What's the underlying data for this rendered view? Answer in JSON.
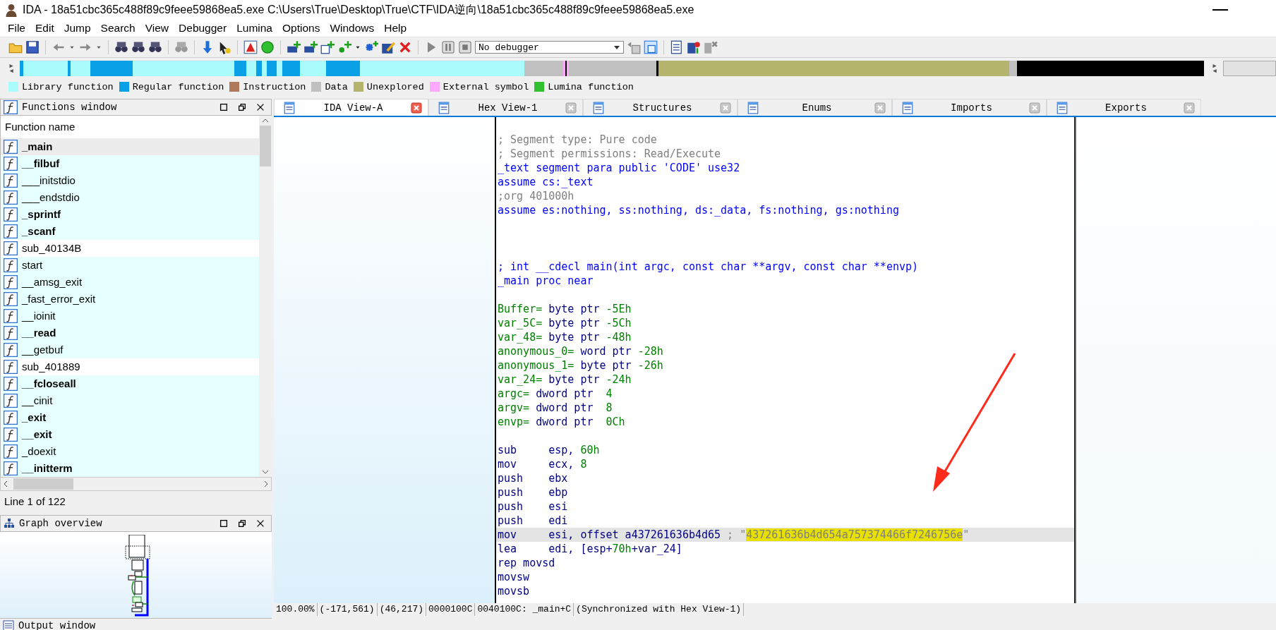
{
  "window": {
    "title": "IDA - 18a51cbc365c488f89c9feee59868ea5.exe C:\\Users\\True\\Desktop\\True\\CTF\\IDA逆向\\18a51cbc365c488f89c9feee59868ea5.exe"
  },
  "menu": [
    "File",
    "Edit",
    "Jump",
    "Search",
    "View",
    "Debugger",
    "Lumina",
    "Options",
    "Windows",
    "Help"
  ],
  "toolbar": {
    "debugger_select": "No debugger"
  },
  "legend": [
    {
      "label": "Library function",
      "color": "#aafcfc"
    },
    {
      "label": "Regular function",
      "color": "#0aa0e6"
    },
    {
      "label": "Instruction",
      "color": "#b07a5a"
    },
    {
      "label": "Data",
      "color": "#c0c0c0"
    },
    {
      "label": "Unexplored",
      "color": "#b4b46c"
    },
    {
      "label": "External symbol",
      "color": "#ffa8ff"
    },
    {
      "label": "Lumina function",
      "color": "#30c030"
    }
  ],
  "functions_window": {
    "title": "Functions window",
    "column": "Function name",
    "status": "Line 1 of 122",
    "items": [
      {
        "name": "_main",
        "bold": true,
        "kind": "library",
        "selected": true
      },
      {
        "name": "__filbuf",
        "bold": true,
        "kind": "library",
        "selected": false
      },
      {
        "name": "___initstdio",
        "bold": false,
        "kind": "library",
        "selected": false
      },
      {
        "name": "___endstdio",
        "bold": false,
        "kind": "library",
        "selected": false
      },
      {
        "name": "_sprintf",
        "bold": true,
        "kind": "library",
        "selected": false
      },
      {
        "name": "_scanf",
        "bold": true,
        "kind": "library",
        "selected": false
      },
      {
        "name": "sub_40134B",
        "bold": false,
        "kind": "regular",
        "selected": false
      },
      {
        "name": "start",
        "bold": false,
        "kind": "library",
        "selected": false
      },
      {
        "name": "__amsg_exit",
        "bold": false,
        "kind": "library",
        "selected": false
      },
      {
        "name": "_fast_error_exit",
        "bold": false,
        "kind": "library",
        "selected": false
      },
      {
        "name": "__ioinit",
        "bold": false,
        "kind": "library",
        "selected": false
      },
      {
        "name": "__read",
        "bold": true,
        "kind": "library",
        "selected": false
      },
      {
        "name": "__getbuf",
        "bold": false,
        "kind": "library",
        "selected": false
      },
      {
        "name": "sub_401889",
        "bold": false,
        "kind": "regular",
        "selected": false
      },
      {
        "name": "__fcloseall",
        "bold": true,
        "kind": "library",
        "selected": false
      },
      {
        "name": "__cinit",
        "bold": false,
        "kind": "library",
        "selected": false
      },
      {
        "name": "_exit",
        "bold": true,
        "kind": "library",
        "selected": false
      },
      {
        "name": "__exit",
        "bold": true,
        "kind": "library",
        "selected": false
      },
      {
        "name": "_doexit",
        "bold": false,
        "kind": "library",
        "selected": false
      },
      {
        "name": "__initterm",
        "bold": true,
        "kind": "library",
        "selected": false
      }
    ]
  },
  "graph_overview": {
    "title": "Graph overview"
  },
  "tabs": [
    {
      "label": "IDA View-A",
      "selected": true
    },
    {
      "label": "Hex View-1",
      "selected": false
    },
    {
      "label": "Structures",
      "selected": false
    },
    {
      "label": "Enums",
      "selected": false
    },
    {
      "label": "Imports",
      "selected": false
    },
    {
      "label": "Exports",
      "selected": false
    }
  ],
  "disassembly": {
    "lines": [
      {
        "kind": "code",
        "selected": false,
        "tokens": [
          {
            "text": "; Segment type: Pure code",
            "kind": "comment"
          }
        ]
      },
      {
        "kind": "code",
        "selected": false,
        "tokens": [
          {
            "text": "; Segment permissions: Read/Execute",
            "kind": "comment"
          }
        ]
      },
      {
        "kind": "code",
        "selected": false,
        "tokens": [
          {
            "text": "_text segment para public 'CODE' use32",
            "kind": "keyword"
          }
        ]
      },
      {
        "kind": "code",
        "selected": false,
        "tokens": [
          {
            "text": "assume cs:_text",
            "kind": "keyword"
          }
        ]
      },
      {
        "kind": "code",
        "selected": false,
        "tokens": [
          {
            "text": ";org 401000h",
            "kind": "comment"
          }
        ]
      },
      {
        "kind": "code",
        "selected": false,
        "tokens": [
          {
            "text": "assume es:nothing, ss:nothing, ds:_data, fs:nothing, gs:nothing",
            "kind": "keyword"
          }
        ]
      },
      {
        "kind": "blank"
      },
      {
        "kind": "blank"
      },
      {
        "kind": "blank"
      },
      {
        "kind": "code",
        "selected": false,
        "tokens": [
          {
            "text": "; int __cdecl main(int argc, const char **argv, const char **envp)",
            "kind": "keyword"
          }
        ]
      },
      {
        "kind": "code",
        "selected": false,
        "tokens": [
          {
            "text": "_main proc near",
            "kind": "keyword"
          }
        ]
      },
      {
        "kind": "blank"
      },
      {
        "kind": "code",
        "selected": false,
        "tokens": [
          {
            "text": "Buffer=",
            "kind": "var"
          },
          {
            "text": " byte ptr ",
            "kind": "text"
          },
          {
            "text": "-5Eh",
            "kind": "num"
          }
        ]
      },
      {
        "kind": "code",
        "selected": false,
        "tokens": [
          {
            "text": "var_5C=",
            "kind": "var"
          },
          {
            "text": " byte ptr ",
            "kind": "text"
          },
          {
            "text": "-5Ch",
            "kind": "num"
          }
        ]
      },
      {
        "kind": "code",
        "selected": false,
        "tokens": [
          {
            "text": "var_48=",
            "kind": "var"
          },
          {
            "text": " byte ptr ",
            "kind": "text"
          },
          {
            "text": "-48h",
            "kind": "num"
          }
        ]
      },
      {
        "kind": "code",
        "selected": false,
        "tokens": [
          {
            "text": "anonymous_0=",
            "kind": "var"
          },
          {
            "text": " word ptr ",
            "kind": "text"
          },
          {
            "text": "-28h",
            "kind": "num"
          }
        ]
      },
      {
        "kind": "code",
        "selected": false,
        "tokens": [
          {
            "text": "anonymous_1=",
            "kind": "var"
          },
          {
            "text": " byte ptr ",
            "kind": "text"
          },
          {
            "text": "-26h",
            "kind": "num"
          }
        ]
      },
      {
        "kind": "code",
        "selected": false,
        "tokens": [
          {
            "text": "var_24=",
            "kind": "var"
          },
          {
            "text": " byte ptr ",
            "kind": "text"
          },
          {
            "text": "-24h",
            "kind": "num"
          }
        ]
      },
      {
        "kind": "code",
        "selected": false,
        "tokens": [
          {
            "text": "argc=",
            "kind": "var"
          },
          {
            "text": " dword ptr  ",
            "kind": "text"
          },
          {
            "text": "4",
            "kind": "num"
          }
        ]
      },
      {
        "kind": "code",
        "selected": false,
        "tokens": [
          {
            "text": "argv=",
            "kind": "var"
          },
          {
            "text": " dword ptr  ",
            "kind": "text"
          },
          {
            "text": "8",
            "kind": "num"
          }
        ]
      },
      {
        "kind": "code",
        "selected": false,
        "tokens": [
          {
            "text": "envp=",
            "kind": "var"
          },
          {
            "text": " dword ptr  ",
            "kind": "text"
          },
          {
            "text": "0Ch",
            "kind": "num"
          }
        ]
      },
      {
        "kind": "blank"
      },
      {
        "kind": "instr",
        "selected": false,
        "mnemonic": "sub",
        "tokens": [
          {
            "text": "esp, ",
            "kind": "text"
          },
          {
            "text": "60h",
            "kind": "num"
          }
        ]
      },
      {
        "kind": "instr",
        "selected": false,
        "mnemonic": "mov",
        "tokens": [
          {
            "text": "ecx, ",
            "kind": "text"
          },
          {
            "text": "8",
            "kind": "num"
          }
        ]
      },
      {
        "kind": "instr",
        "selected": false,
        "mnemonic": "push",
        "tokens": [
          {
            "text": "ebx",
            "kind": "text"
          }
        ]
      },
      {
        "kind": "instr",
        "selected": false,
        "mnemonic": "push",
        "tokens": [
          {
            "text": "ebp",
            "kind": "text"
          }
        ]
      },
      {
        "kind": "instr",
        "selected": false,
        "mnemonic": "push",
        "tokens": [
          {
            "text": "esi",
            "kind": "text"
          }
        ]
      },
      {
        "kind": "instr",
        "selected": false,
        "mnemonic": "push",
        "tokens": [
          {
            "text": "edi",
            "kind": "text"
          }
        ]
      },
      {
        "kind": "instr",
        "selected": true,
        "mnemonic": "mov",
        "tokens": [
          {
            "text": "esi, offset a437261636b4d65 ",
            "kind": "text"
          },
          {
            "text": "; \"",
            "kind": "comment"
          },
          {
            "text": "437261636b4d654a757374466f7246756e",
            "kind": "highlight"
          },
          {
            "text": "\"",
            "kind": "comment"
          }
        ]
      },
      {
        "kind": "instr",
        "selected": false,
        "mnemonic": "lea",
        "tokens": [
          {
            "text": "edi, [esp+",
            "kind": "text"
          },
          {
            "text": "70h",
            "kind": "num"
          },
          {
            "text": "+var_24]",
            "kind": "text"
          }
        ]
      },
      {
        "kind": "code",
        "selected": false,
        "tokens": [
          {
            "text": "rep movsd",
            "kind": "text"
          }
        ]
      },
      {
        "kind": "code",
        "selected": false,
        "tokens": [
          {
            "text": "movsw",
            "kind": "text"
          }
        ]
      },
      {
        "kind": "code",
        "selected": false,
        "tokens": [
          {
            "text": "movsb",
            "kind": "text"
          }
        ]
      }
    ]
  },
  "status_bar": [
    "100.00%",
    "(-171,561)",
    "(46,217)",
    "0000100C",
    "0040100C: _main+C",
    "(Synchronized with Hex View-1)"
  ],
  "output_window": {
    "title": "Output window"
  }
}
